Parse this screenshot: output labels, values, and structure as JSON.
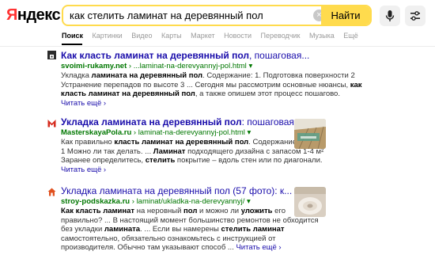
{
  "logo": {
    "first_letter": "Я",
    "rest": "ндекс"
  },
  "search": {
    "query": "как стелить ламинат на деревянный пол",
    "clear_symbol": "×",
    "find_label": "Найти"
  },
  "tabs": [
    {
      "label": "Поиск",
      "active": true
    },
    {
      "label": "Картинки"
    },
    {
      "label": "Видео"
    },
    {
      "label": "Карты"
    },
    {
      "label": "Маркет"
    },
    {
      "label": "Новости"
    },
    {
      "label": "Переводчик"
    },
    {
      "label": "Музыка"
    },
    {
      "label": "Ещё"
    }
  ],
  "results": [
    {
      "title_bold": "Как класть ламинат на деревянный пол",
      "title_rest": ", пошаговая...",
      "host": "svoimi-rukamy.net",
      "path": "› ...laminat-na-derevyannyj-pol.html",
      "caret": "▾",
      "snippet": [
        [
          "Укладка ",
          "ламината на деревянный пол",
          ". Содержание: 1. Подготовка поверхности 2"
        ],
        [
          "Устранение перепадов по высоте 3 ... Сегодня мы рассмотрим основные нюансы, ",
          "как",
          ""
        ],
        [
          "",
          "класть ламинат на деревянный пол",
          ", а также опишем этот процесс пошагово."
        ]
      ],
      "read_more": "Читать ещё ›",
      "favicon_color": "#2b2b2b"
    },
    {
      "title_bold": "Укладка ламината на деревянный пол",
      "title_rest": ": пошаговая...",
      "host": "MasterskayaPola.ru",
      "path": "› laminat-na-derevyannyj-pol.html",
      "caret": "▾",
      "snippet": [
        [
          "Как правильно ",
          "класть ламинат на деревянный пол",
          ". Содержание статьи."
        ],
        [
          "1 Можно ли так делать. ... ",
          "Ламинат",
          " подходящего дизайна с запасом 1-4 м²"
        ],
        [
          "Заранее определитесь, ",
          "стелить",
          " покрытие – вдоль стен или по диагонали."
        ]
      ],
      "read_more": "Читать ещё ›",
      "favicon_color": "#d52b1e"
    },
    {
      "title_bold": "Укладка ламината на деревянный пол",
      "title_rest": " (57 фото): к...",
      "host": "stroy-podskazka.ru",
      "path": "› laminat/ukladka-na-derevyannyj/",
      "caret": "▾",
      "snippet": [
        [
          "",
          "Как класть ламинат",
          " на неровный ",
          "пол",
          " и можно ли ",
          "уложить",
          " его"
        ],
        [
          "правильно? ... В настоящий момент большинство ремонтов не обходится"
        ],
        [
          "без укладки ",
          "ламината",
          ". ... Если вы намерены ",
          "стелить ламинат",
          ""
        ],
        [
          "самостоятельно, обязательно ознакомьтесь с инструкцией от"
        ],
        [
          "производителя. Обычно там указывают способ ...",
          ""
        ]
      ],
      "read_more": "Читать ещё ›",
      "favicon_color": "#e0501e"
    }
  ]
}
